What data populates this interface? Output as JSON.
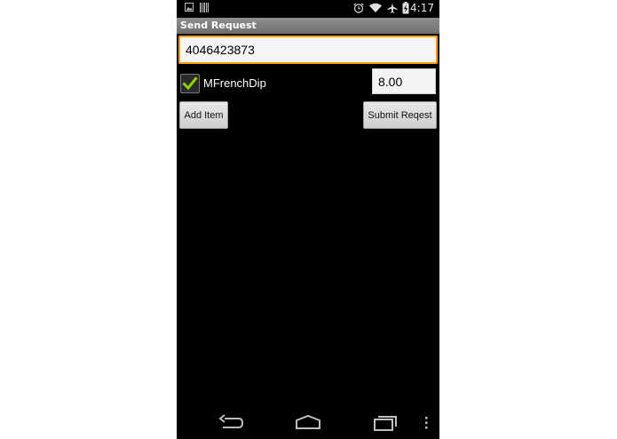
{
  "status_bar": {
    "time": "4:17",
    "icons": [
      "image-notification-icon",
      "barcode-notification-icon",
      "alarm-icon",
      "wifi-icon",
      "airplane-mode-icon",
      "battery-charging-icon"
    ]
  },
  "title_bar": {
    "title": "Send Request"
  },
  "form": {
    "phone_number": "4046423873",
    "item": {
      "label": "MFrenchDip",
      "checked": true,
      "price": "8.00"
    },
    "add_item_label": "Add Item",
    "submit_label": "Submit Reqest"
  },
  "nav_bar": {
    "icons": [
      "back-icon",
      "home-icon",
      "recent-apps-icon",
      "overflow-menu-icon"
    ]
  },
  "colors": {
    "accent": "#ff9c00",
    "check": "#8fd400",
    "title_bar": "#7a7a7a",
    "background": "#000000"
  }
}
